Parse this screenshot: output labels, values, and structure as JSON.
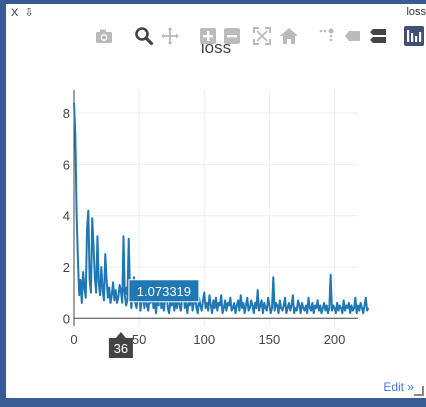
{
  "pane": {
    "close_label": "X",
    "pin_label": "⇩",
    "title": "loss"
  },
  "modebar": {
    "buttons": [
      {
        "name": "camera-icon"
      },
      {
        "name": "zoom-icon"
      },
      {
        "name": "pan-icon"
      },
      {
        "name": "zoom-in-icon"
      },
      {
        "name": "zoom-out-icon"
      },
      {
        "name": "autoscale-icon"
      },
      {
        "name": "home-icon"
      },
      {
        "name": "spike-lines-icon"
      },
      {
        "name": "hover-closest-icon"
      },
      {
        "name": "hover-compare-icon"
      },
      {
        "name": "plotly-logo-icon"
      }
    ]
  },
  "edit_label": "Edit »",
  "colors": {
    "line": "#1f77b4",
    "hover_box": "#1f77b4",
    "spike_label": "#444444",
    "grid": "#eeeeee",
    "frame": "#3a5a93"
  },
  "chart_data": {
    "type": "line",
    "title": "loss",
    "xlabel": "",
    "ylabel": "",
    "xlim": [
      0,
      218
    ],
    "ylim": [
      -0.3,
      8.9
    ],
    "x_ticks": [
      0,
      50,
      100,
      150,
      200
    ],
    "y_ticks": [
      0,
      2,
      4,
      6,
      8
    ],
    "grid": true,
    "hover": {
      "x": 36,
      "y": 1.073319,
      "label": "1.073319",
      "x_label": "36"
    },
    "series": [
      {
        "values": [
          8.4,
          7.2,
          4.1,
          2.3,
          0.9,
          1.5,
          0.6,
          1.8,
          1.2,
          0.8,
          3.5,
          4.2,
          1.5,
          1.0,
          3.9,
          2.8,
          1.6,
          1.0,
          3.2,
          1.4,
          0.9,
          2.0,
          1.1,
          0.7,
          2.5,
          1.5,
          0.8,
          1.2,
          0.6,
          0.9,
          1.4,
          0.7,
          1.1,
          0.6,
          0.8,
          1.3,
          1.07,
          0.6,
          3.2,
          0.9,
          0.5,
          0.7,
          3.1,
          1.0,
          0.4,
          0.9,
          1.6,
          0.6,
          0.4,
          0.8,
          1.2,
          0.3,
          0.7,
          0.9,
          0.4,
          1.1,
          0.5,
          0.3,
          0.8,
          0.6,
          1.0,
          0.4,
          0.7,
          0.2,
          0.9,
          0.5,
          1.3,
          0.4,
          0.6,
          0.3,
          0.8,
          1.1,
          0.4,
          0.2,
          0.7,
          0.5,
          0.9,
          0.3,
          0.6,
          0.4,
          1.0,
          0.5,
          0.3,
          0.8,
          1.2,
          0.4,
          0.6,
          0.2,
          0.7,
          0.5,
          1.1,
          0.3,
          0.6,
          0.9,
          0.4,
          0.2,
          0.8,
          0.5,
          0.3,
          0.7,
          1.0,
          0.4,
          0.6,
          0.3,
          0.9,
          0.5,
          0.2,
          0.7,
          0.4,
          0.8,
          0.3,
          0.6,
          0.5,
          0.9,
          0.2,
          0.4,
          0.7,
          0.3,
          0.6,
          0.5,
          0.8,
          0.3,
          0.4,
          0.6,
          0.2,
          0.5,
          0.7,
          0.3,
          0.9,
          0.4,
          0.6,
          0.2,
          0.5,
          0.8,
          0.3,
          0.4,
          0.7,
          0.5,
          0.2,
          0.6,
          0.4,
          1.1,
          0.3,
          0.5,
          0.7,
          0.2,
          0.6,
          0.4,
          0.3,
          0.8,
          0.5,
          0.2,
          0.4,
          1.6,
          0.3,
          0.6,
          0.5,
          0.2,
          0.7,
          0.4,
          0.3,
          0.5,
          0.8,
          0.2,
          0.4,
          0.6,
          0.3,
          0.5,
          0.9,
          0.2,
          0.4,
          0.3,
          0.7,
          0.5,
          0.2,
          0.6,
          0.4,
          0.3,
          0.5,
          0.2,
          0.8,
          0.4,
          0.3,
          0.6,
          0.2,
          0.5,
          0.4,
          0.7,
          0.3,
          0.5,
          0.2,
          0.4,
          0.6,
          0.3,
          0.5,
          0.2,
          0.4,
          1.7,
          0.3,
          0.5,
          0.4,
          0.2,
          0.6,
          0.3,
          0.5,
          0.4,
          0.2,
          0.7,
          0.3,
          0.5,
          0.4,
          0.6,
          0.2,
          0.5,
          0.3,
          0.4,
          0.8,
          0.2,
          0.5,
          0.3,
          0.6,
          0.4,
          0.2,
          0.5,
          0.8,
          0.3,
          0.4
        ]
      }
    ]
  }
}
